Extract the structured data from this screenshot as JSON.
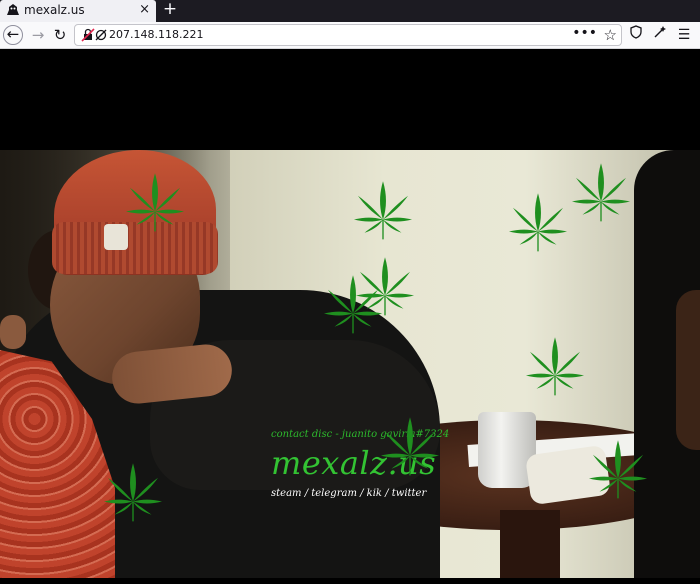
{
  "browser": {
    "tab_title": "mexalz.us",
    "tab_close": "×",
    "new_tab": "+",
    "url": "207.148.118.221",
    "back_icon": "back-arrow-icon",
    "forward_icon": "forward-arrow-icon",
    "reload_icon": "reload-icon",
    "more_label": "•••",
    "star_label": "☆",
    "toolbar_icons": [
      "shield-icon",
      "extension-icon",
      "menu-icon"
    ]
  },
  "page": {
    "contact_text": "contact disc - juanito gaviria#7324",
    "title": "mexalz.us",
    "links": [
      "steam",
      "telegram",
      "kik",
      "twitter"
    ],
    "link_separator": " / ",
    "leaf_count": 11,
    "colors": {
      "title": "#33c333",
      "leaf": "#1f8f1f",
      "background": "#000000"
    }
  }
}
